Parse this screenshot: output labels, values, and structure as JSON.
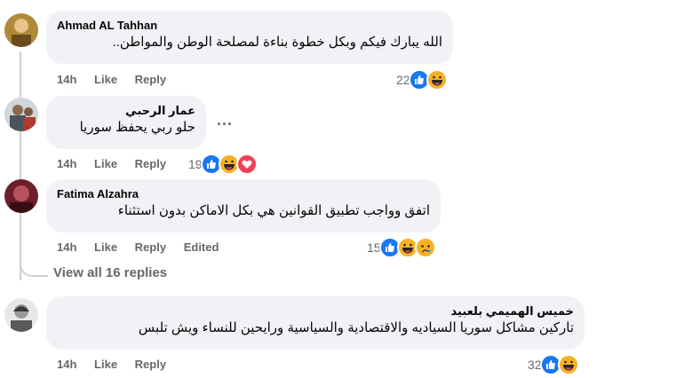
{
  "comments": [
    {
      "author": "Ahmad AL Tahhan",
      "text": "الله يبارك فيكم وبكل خطوة بناءة لمصلحة الوطن والمواطن..",
      "time": "14h",
      "like_label": "Like",
      "reply_label": "Reply",
      "reaction_count": "22",
      "reactions": [
        "like-icon",
        "haha-icon"
      ]
    },
    {
      "author": "عمار الرحبي",
      "text": "حلو ربي يحفظ سوريا",
      "time": "14h",
      "like_label": "Like",
      "reply_label": "Reply",
      "reaction_count": "19",
      "reactions": [
        "like-icon",
        "haha-icon",
        "love-icon"
      ],
      "more_label": "..."
    },
    {
      "author": "Fatima Alzahra",
      "text": "اتفق وواجب تطبيق القوانين هي بكل الاماكن بدون استثناء",
      "time": "14h",
      "like_label": "Like",
      "reply_label": "Reply",
      "edited_label": "Edited",
      "reaction_count": "15",
      "reactions": [
        "like-icon",
        "haha-icon",
        "sad-icon"
      ]
    },
    {
      "author": "خميس الهميمي بلعبيد",
      "text": "تاركين مشاكل سوريا السياديه والاقتصادية والسياسية ورايحين للنساء ويش تلبس",
      "time": "14h",
      "like_label": "Like",
      "reply_label": "Reply",
      "reaction_count": "32",
      "reactions": [
        "like-icon",
        "haha-icon"
      ]
    }
  ],
  "view_replies": "View all 16 replies",
  "colors": {
    "bubble": "#f0f2f5",
    "secondary_text": "#65676b",
    "like": "#1877f2",
    "love": "#f33e58",
    "haha": "#f7b125"
  }
}
